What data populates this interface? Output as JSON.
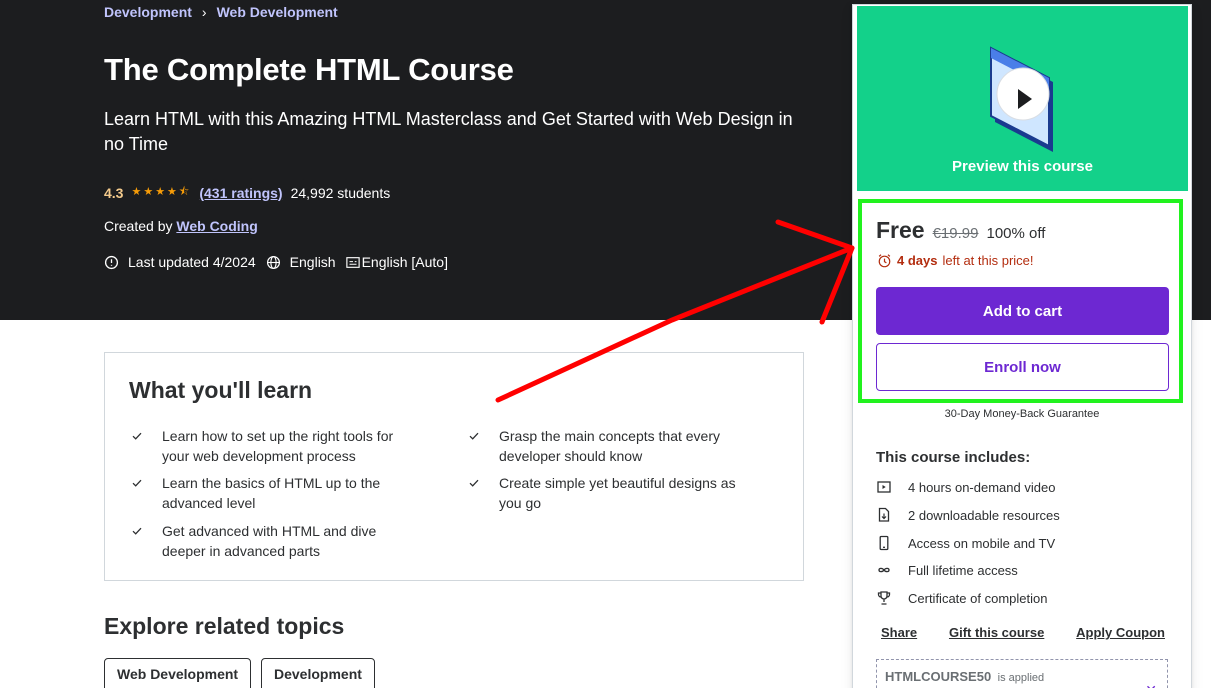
{
  "breadcrumb": {
    "items": [
      "Development",
      "Web Development"
    ],
    "separator": "›"
  },
  "course": {
    "title": "The Complete HTML Course",
    "subtitle": "Learn HTML with this Amazing HTML Masterclass and Get Started with Web Design in no Time",
    "rating": "4.3",
    "rating_stars": 4.3,
    "ratings_count": "(431 ratings)",
    "students": "24,992 students",
    "created_by_label": "Created by",
    "author": "Web Coding",
    "last_updated": "Last updated 4/2024",
    "language": "English",
    "captions": "English [Auto]"
  },
  "learn": {
    "title": "What you'll learn",
    "items": [
      "Learn how to set up the right tools for your web development process",
      "Grasp the main concepts that every developer should know",
      "Learn the basics of HTML up to the advanced level",
      "Create simple yet beautiful designs as you go",
      "Get advanced with HTML and dive deeper in advanced parts"
    ]
  },
  "topics": {
    "title": "Explore related topics",
    "chips": [
      "Web Development",
      "Development"
    ]
  },
  "sidebar": {
    "preview_label": "Preview this course",
    "price_now": "Free",
    "price_old": "€19.99",
    "discount": "100% off",
    "timer_bold": "4 days",
    "timer_rest": "left at this price!",
    "add_to_cart": "Add to cart",
    "enroll_now": "Enroll now",
    "guarantee": "30-Day Money-Back Guarantee",
    "includes_title": "This course includes:",
    "includes": [
      {
        "icon": "video-icon",
        "label": "4 hours on-demand video"
      },
      {
        "icon": "download-file-icon",
        "label": "2 downloadable resources"
      },
      {
        "icon": "mobile-icon",
        "label": "Access on mobile and TV"
      },
      {
        "icon": "infinity-icon",
        "label": "Full lifetime access"
      },
      {
        "icon": "trophy-icon",
        "label": "Certificate of completion"
      }
    ],
    "links": {
      "share": "Share",
      "gift": "Gift this course",
      "apply": "Apply Coupon"
    },
    "coupon_code": "HTMLCOURSE50",
    "coupon_status": "is applied"
  },
  "colors": {
    "hero_bg": "#1c1d1f",
    "accent_purple": "#6d28d2",
    "link_lavender": "#c0c4fc",
    "preview_green": "#13d18a",
    "highlight_green": "#21f21e",
    "annotation_red": "#ff0000",
    "timer_red": "#b32d0f"
  }
}
